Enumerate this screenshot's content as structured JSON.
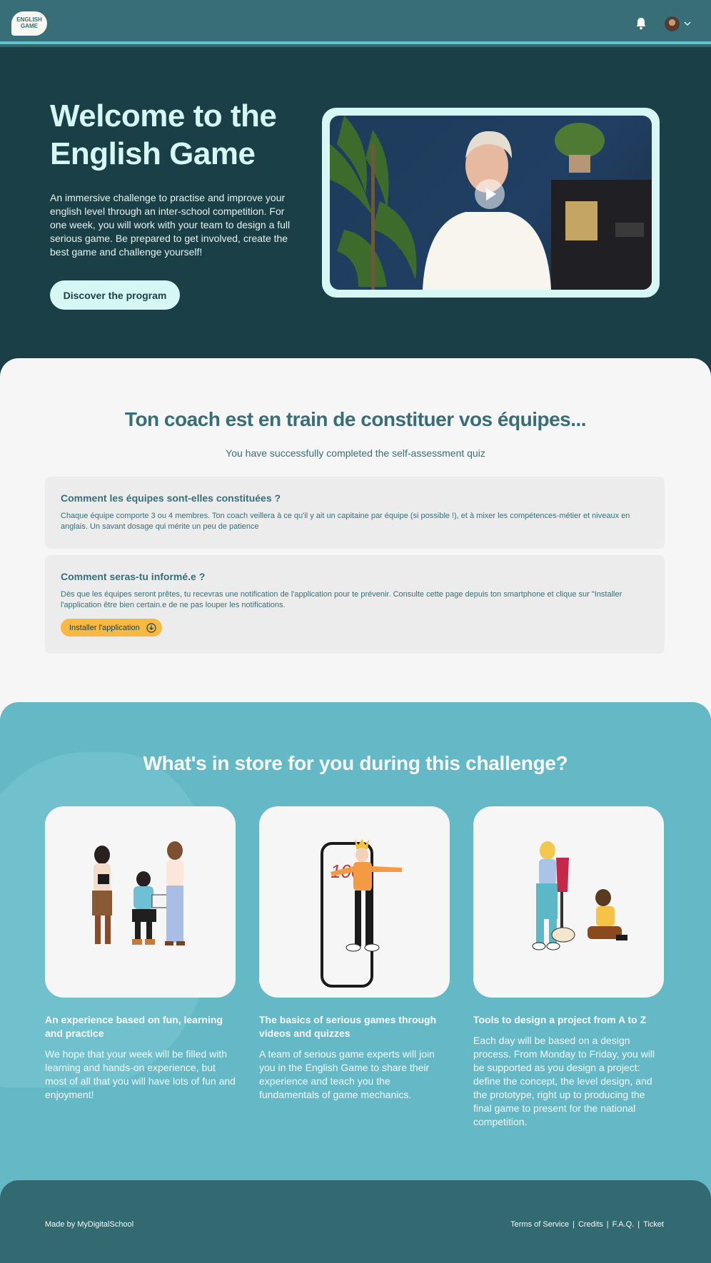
{
  "navbar": {
    "logo_text": "ENGLISH GAME",
    "icons": [
      "bell-icon",
      "avatar",
      "chevron-down-icon"
    ]
  },
  "hero": {
    "title": "Welcome to the English Game",
    "text": "An immersive challenge to practise and improve your english level through an inter-school competition. For one week, you will work with your team to design a full serious game. Be prepared to get involved, create the best game and challenge yourself!",
    "button_label": "Discover the program"
  },
  "coach": {
    "title": "Ton coach est en train de constituer vos équipes...",
    "subtitle": "You have successfully completed the self-assessment quiz",
    "card1": {
      "title": "Comment les équipes sont-elles constituées ?",
      "text": "Chaque équipe comporte 3 ou 4 membres. Ton coach veillera à ce qu'il y ait un capitaine par équipe (si possible !), et à mixer les compétences-métier et niveaux en anglais. Un savant dosage qui mérite un peu de patience"
    },
    "card2": {
      "title": "Comment seras-tu informé.e ?",
      "text": "Dès que les équipes seront prêtes, tu recevras une notification de l'application pour te prévenir. Consulte cette page depuis ton smartphone et clique sur \"Installer l'application être bien certain.e de ne pas louper les notifications.",
      "button_label": "Installer l'application"
    }
  },
  "challenge": {
    "title": "What's in store for you during this challenge?",
    "features": [
      {
        "title": "An experience based on fun, learning and practice",
        "text": "We hope that your week will be filled with learning and hands-on experience, but most of all that you will have lots of fun and enjoyment!"
      },
      {
        "title": "The basics of serious games through videos and quizzes",
        "text": "A team of serious game experts will join you in the English Game to share their experience and teach you the fundamentals of game mechanics.",
        "illustration_text": "100"
      },
      {
        "title": "Tools to design a project from A to Z",
        "text": "Each day will be based on a design process. From Monday to Friday, you will be supported as you design a project: define the concept, the level design, and the prototype, right up to producing the final game to present for the national competition."
      }
    ]
  },
  "footer": {
    "made_by": "Made by MyDigitalSchool",
    "links": [
      "Terms of Service",
      "Credits",
      "F.A.Q.",
      "Ticket"
    ]
  },
  "colors": {
    "navbar": "#376e77",
    "hero_bg": "#1b3f47",
    "accent_light": "#d6f7f3",
    "challenge_bg": "#65b8c6",
    "install_button": "#f7b942"
  }
}
